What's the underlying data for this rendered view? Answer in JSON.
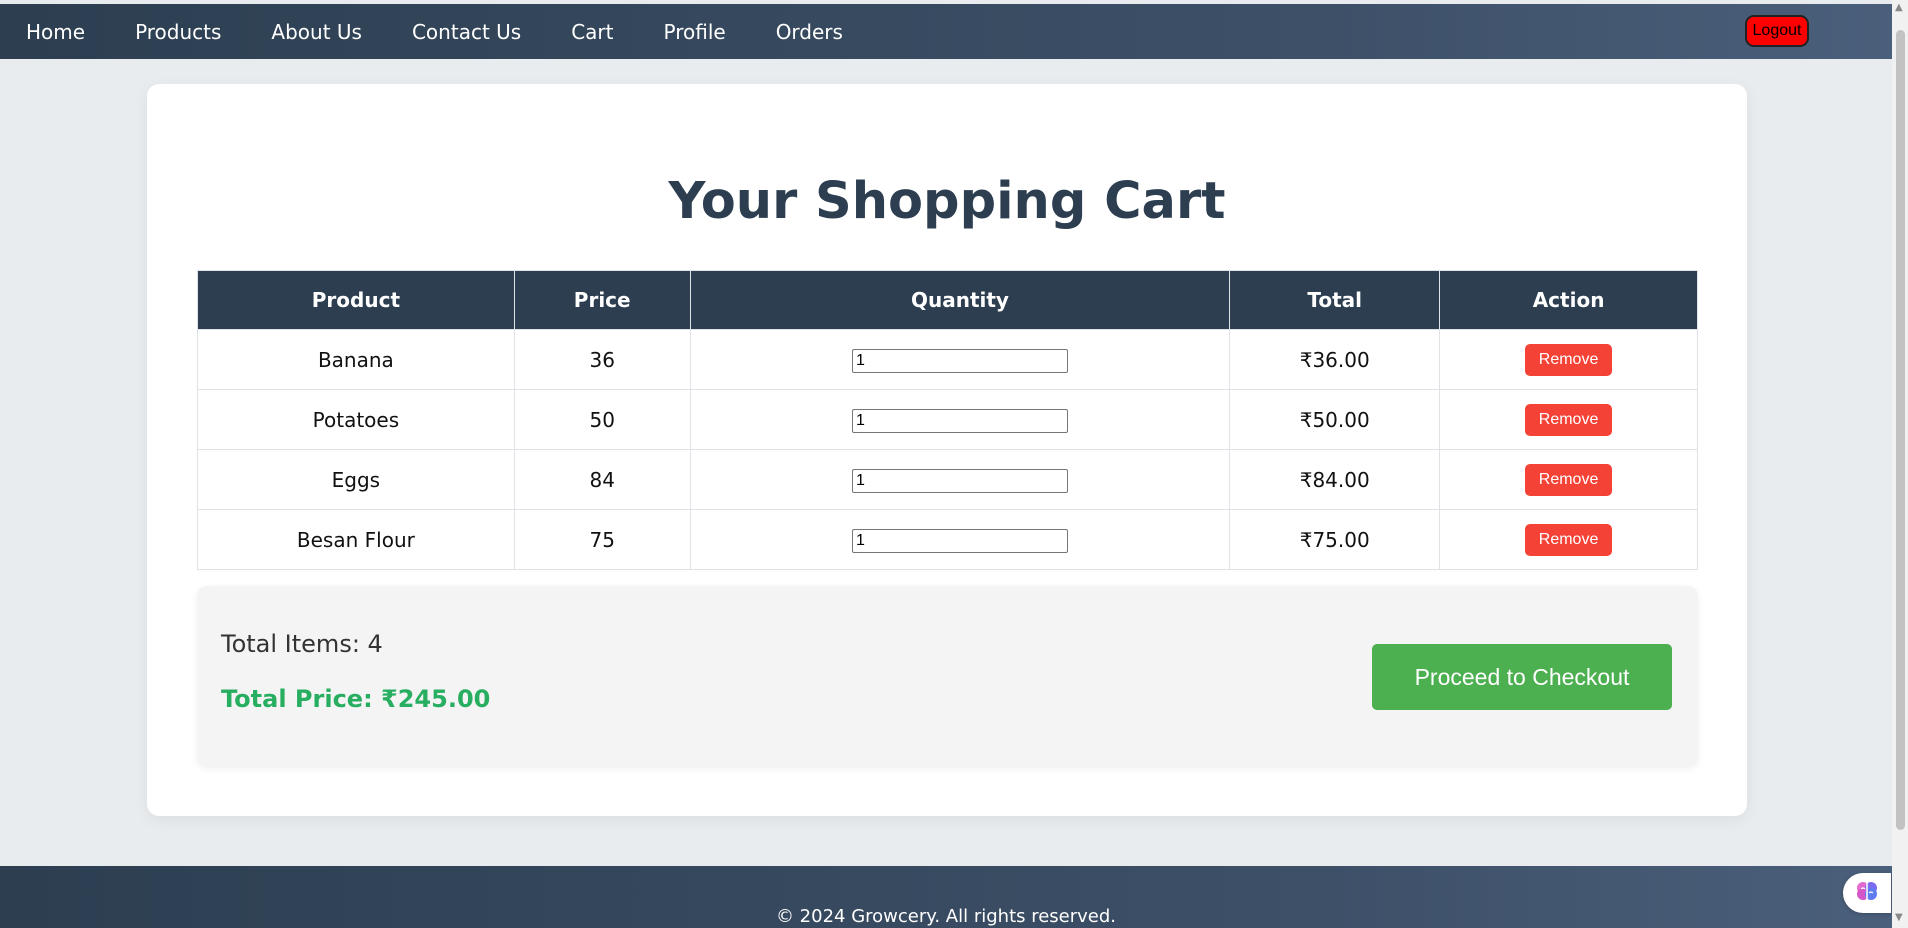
{
  "nav": {
    "items": [
      {
        "label": "Home",
        "name": "nav-home"
      },
      {
        "label": "Products",
        "name": "nav-products"
      },
      {
        "label": "About Us",
        "name": "nav-about-us"
      },
      {
        "label": "Contact Us",
        "name": "nav-contact-us"
      },
      {
        "label": "Cart",
        "name": "nav-cart"
      },
      {
        "label": "Profile",
        "name": "nav-profile"
      },
      {
        "label": "Orders",
        "name": "nav-orders"
      }
    ],
    "logout_label": "Logout"
  },
  "cart": {
    "title": "Your Shopping Cart",
    "columns": [
      "Product",
      "Price",
      "Quantity",
      "Total",
      "Action"
    ],
    "rows": [
      {
        "product": "Banana",
        "price": "36",
        "quantity": "1",
        "total": "₹36.00",
        "action": "Remove"
      },
      {
        "product": "Potatoes",
        "price": "50",
        "quantity": "1",
        "total": "₹50.00",
        "action": "Remove"
      },
      {
        "product": "Eggs",
        "price": "84",
        "quantity": "1",
        "total": "₹84.00",
        "action": "Remove"
      },
      {
        "product": "Besan Flour",
        "price": "75",
        "quantity": "1",
        "total": "₹75.00",
        "action": "Remove"
      }
    ]
  },
  "summary": {
    "total_items": "Total Items: 4",
    "total_price": "Total Price: ₹245.00",
    "checkout_label": "Proceed to Checkout"
  },
  "footer": {
    "text": "© 2024 Growcery. All rights reserved."
  },
  "icons": {
    "assistant": "brain-icon"
  },
  "colors": {
    "nav_bg": "#2c3e50",
    "remove": "#f44336",
    "checkout": "#4caf50",
    "price_text": "#27ae60",
    "logout": "#ff0000"
  }
}
